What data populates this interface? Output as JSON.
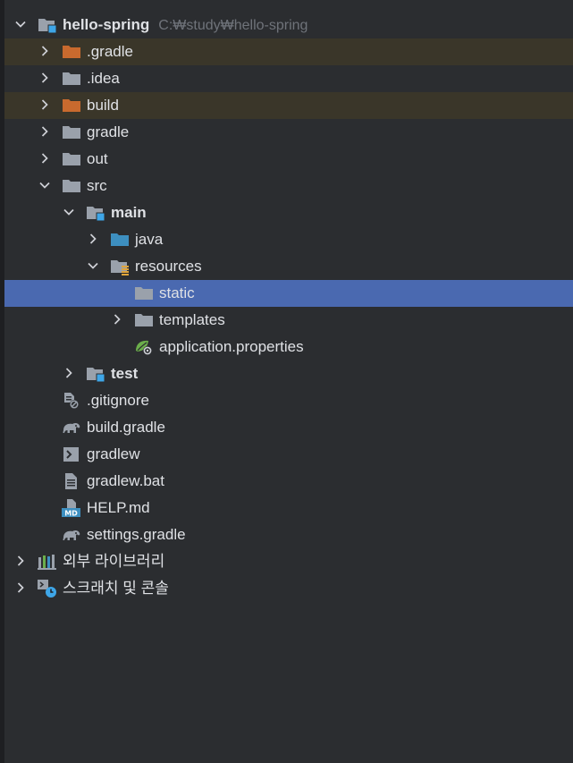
{
  "project": {
    "name": "hello-spring",
    "path": "C:₩study₩hello-spring"
  },
  "items": [
    {
      "label": ".gradle"
    },
    {
      "label": ".idea"
    },
    {
      "label": "build"
    },
    {
      "label": "gradle"
    },
    {
      "label": "out"
    },
    {
      "label": "src"
    },
    {
      "label": "main"
    },
    {
      "label": "java"
    },
    {
      "label": "resources"
    },
    {
      "label": "static"
    },
    {
      "label": "templates"
    },
    {
      "label": "application.properties"
    },
    {
      "label": "test"
    },
    {
      "label": ".gitignore"
    },
    {
      "label": "build.gradle"
    },
    {
      "label": "gradlew"
    },
    {
      "label": "gradlew.bat"
    },
    {
      "label": "HELP.md"
    },
    {
      "label": "settings.gradle"
    },
    {
      "label": "외부 라이브러리"
    },
    {
      "label": "스크래치 및 콘솔"
    }
  ],
  "colors": {
    "background": "#2b2d30",
    "selection": "#4a69b0",
    "excluded_row": "#3a3629",
    "folder_gray": "#9aa1ab",
    "folder_excluded": "#c96a2e",
    "folder_source": "#3d8fc0",
    "module_marker": "#3ea6e8"
  },
  "icons": {
    "project": "module-folder-icon",
    "folder": "folder-icon",
    "excluded_folder": "excluded-folder-icon",
    "source_folder": "source-root-folder-icon",
    "resources_folder": "resources-root-folder-icon",
    "spring_properties": "spring-properties-icon",
    "ignore_file": "gitignore-file-icon",
    "gradle_file": "gradle-elephant-icon",
    "shell_file": "shell-script-icon",
    "text_file": "text-file-icon",
    "markdown_file": "markdown-file-icon",
    "libraries": "libraries-icon",
    "scratches": "scratches-console-icon"
  }
}
